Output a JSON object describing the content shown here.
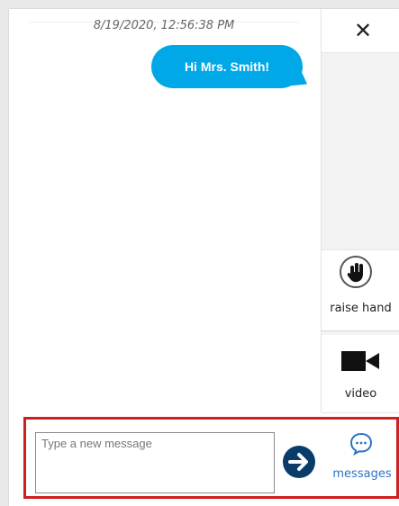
{
  "chat": {
    "timestamp": "8/19/2020, 12:56:38 PM",
    "message": "Hi Mrs. Smith!"
  },
  "toolbar": {
    "close_label": "✕",
    "raise_hand_label": "raise hand",
    "video_label": "video",
    "messages_label": "messages"
  },
  "composer": {
    "placeholder": "Type a new message"
  },
  "colors": {
    "accent_blue": "#00a8e8",
    "send_button": "#0a3c69",
    "messages_blue": "#2e73c7",
    "highlight_red": "#cc1f1f"
  }
}
